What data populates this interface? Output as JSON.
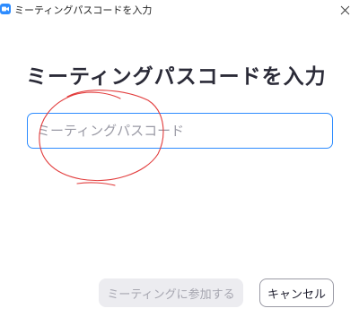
{
  "window": {
    "title": "ミーティングパスコードを入力",
    "close_glyph": "✕"
  },
  "main": {
    "heading": "ミーティングパスコードを入力",
    "input": {
      "placeholder": "ミーティングパスコード",
      "value": ""
    }
  },
  "buttons": {
    "join_label": "ミーティングに参加する",
    "cancel_label": "キャンセル"
  },
  "colors": {
    "accent": "#2D8CFF",
    "annotation": "#e23c3c"
  },
  "icons": {
    "app": "zoom-camera-icon",
    "close": "close-icon"
  }
}
